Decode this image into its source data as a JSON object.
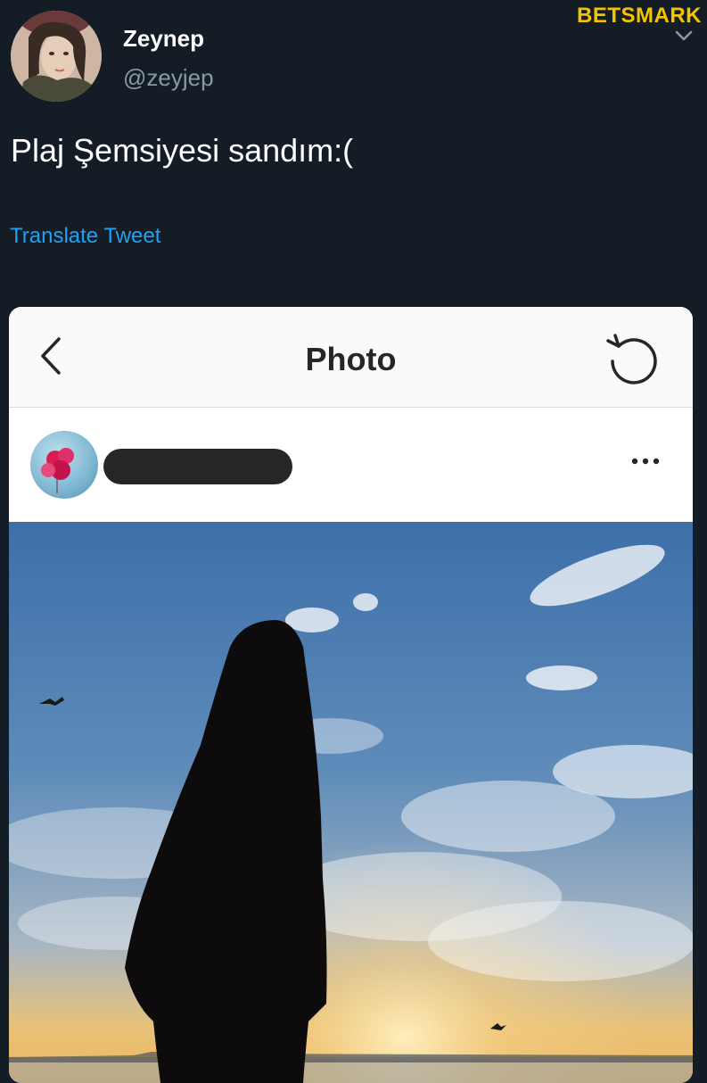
{
  "tweet": {
    "display_name": "Zeynep",
    "handle": "@zeyjep",
    "text": "Plaj Şemsiyesi sandım:(",
    "translate_label": "Translate Tweet",
    "avatar_icon": "profile-photo",
    "menu_icon": "chevron-down-icon"
  },
  "watermark": {
    "text": "BETSMARK",
    "color": "#f5c400"
  },
  "embedded_screenshot": {
    "title": "Photo",
    "back_icon": "chevron-left-icon",
    "refresh_icon": "refresh-icon",
    "more_icon": "more-horizontal-icon"
  },
  "colors": {
    "background": "#141d26",
    "link": "#1da1f2",
    "handle": "#8899a6"
  }
}
